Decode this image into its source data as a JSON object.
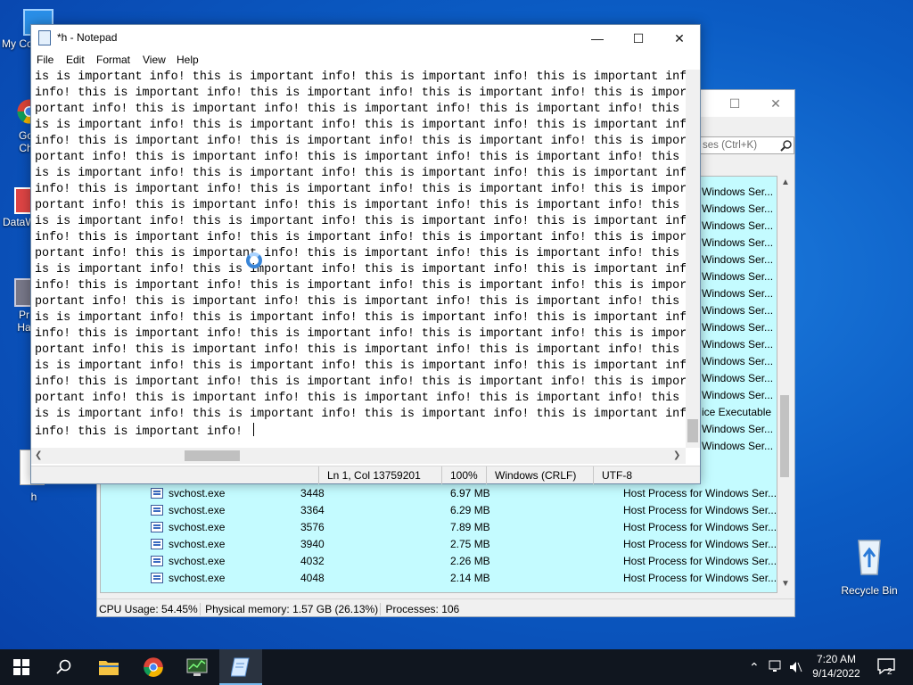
{
  "desktop": {
    "icons": [
      {
        "label": "My Co",
        "name": "this-pc-icon"
      },
      {
        "label": "Go Ch",
        "name": "chrome-desktop-icon"
      },
      {
        "label": "DataW",
        "name": "datawrapper-icon"
      },
      {
        "label": "Pr Ha",
        "name": "process-hacker-desktop-icon"
      },
      {
        "label": "h",
        "name": "text-file-h-icon"
      },
      {
        "label": "Recycle Bin",
        "name": "recycle-bin-icon"
      }
    ]
  },
  "process_hacker": {
    "search_placeholder": "ses (Ctrl+K)",
    "highlight_color": "#c4fbff",
    "desc_fragments": [
      "Windows Ser...",
      "Windows Ser...",
      "Windows Ser...",
      "Windows Ser...",
      "Windows Ser...",
      "Windows Ser...",
      "Windows Ser...",
      "Windows Ser...",
      "Windows Ser...",
      "Windows Ser...",
      "Windows Ser...",
      "Windows Ser...",
      "Windows Ser...",
      "ice Executable",
      "Windows Ser...",
      "Windows Ser..."
    ],
    "rows": [
      {
        "name": "svchost.exe",
        "pid": "3448",
        "memory": "6.97 MB",
        "description": "Host Process for Windows Ser..."
      },
      {
        "name": "svchost.exe",
        "pid": "3364",
        "memory": "6.29 MB",
        "description": "Host Process for Windows Ser..."
      },
      {
        "name": "svchost.exe",
        "pid": "3576",
        "memory": "7.89 MB",
        "description": "Host Process for Windows Ser..."
      },
      {
        "name": "svchost.exe",
        "pid": "3940",
        "memory": "2.75 MB",
        "description": "Host Process for Windows Ser..."
      },
      {
        "name": "svchost.exe",
        "pid": "4032",
        "memory": "2.26 MB",
        "description": "Host Process for Windows Ser..."
      },
      {
        "name": "svchost.exe",
        "pid": "4048",
        "memory": "2.14 MB",
        "description": "Host Process for Windows Ser..."
      }
    ],
    "status": {
      "cpu": "CPU Usage: 54.45%",
      "memory": "Physical memory: 1.57 GB (26.13%)",
      "processes": "Processes: 106"
    }
  },
  "notepad": {
    "title": "*h - Notepad",
    "menu": [
      "File",
      "Edit",
      "Format",
      "View",
      "Help"
    ],
    "lines": [
      "is is important info! this is important info! this is important info! this is important inf",
      "info! this is important info! this is important info! this is important info! this is impor",
      "portant info! this is important info! this is important info! this is important info! this",
      "is is important info! this is important info! this is important info! this is important inf",
      "info! this is important info! this is important info! this is important info! this is impor",
      "portant info! this is important info! this is important info! this is important info! this",
      "is is important info! this is important info! this is important info! this is important inf",
      "info! this is important info! this is important info! this is important info! this is impor",
      "portant info! this is important info! this is important info! this is important info! this",
      "is is important info! this is important info! this is important info! this is important inf",
      "info! this is important info! this is important info! this is important info! this is impor",
      "portant info! this is important info! this is important info! this is important info! this",
      "is is important info! this is important info! this is important info! this is important inf",
      "info! this is important info! this is important info! this is important info! this is impor",
      "portant info! this is important info! this is important info! this is important info! this",
      "is is important info! this is important info! this is important info! this is important inf",
      "info! this is important info! this is important info! this is important info! this is impor",
      "portant info! this is important info! this is important info! this is important info! this",
      "is is important info! this is important info! this is important info! this is important inf",
      "info! this is important info! this is important info! this is important info! this is impor",
      "portant info! this is important info! this is important info! this is important info! this",
      "is is important info! this is important info! this is important info! this is important inf",
      "info! this is important info! "
    ],
    "status": {
      "position": "Ln 1, Col 13759201",
      "zoom": "100%",
      "line_ending": "Windows (CRLF)",
      "encoding": "UTF-8"
    }
  },
  "taskbar": {
    "items": [
      "start-button",
      "search-button",
      "file-explorer-button",
      "chrome-button",
      "process-hacker-button",
      "notepad-button"
    ],
    "time": "7:20 AM",
    "date": "9/14/2022",
    "notification_count": "2"
  }
}
